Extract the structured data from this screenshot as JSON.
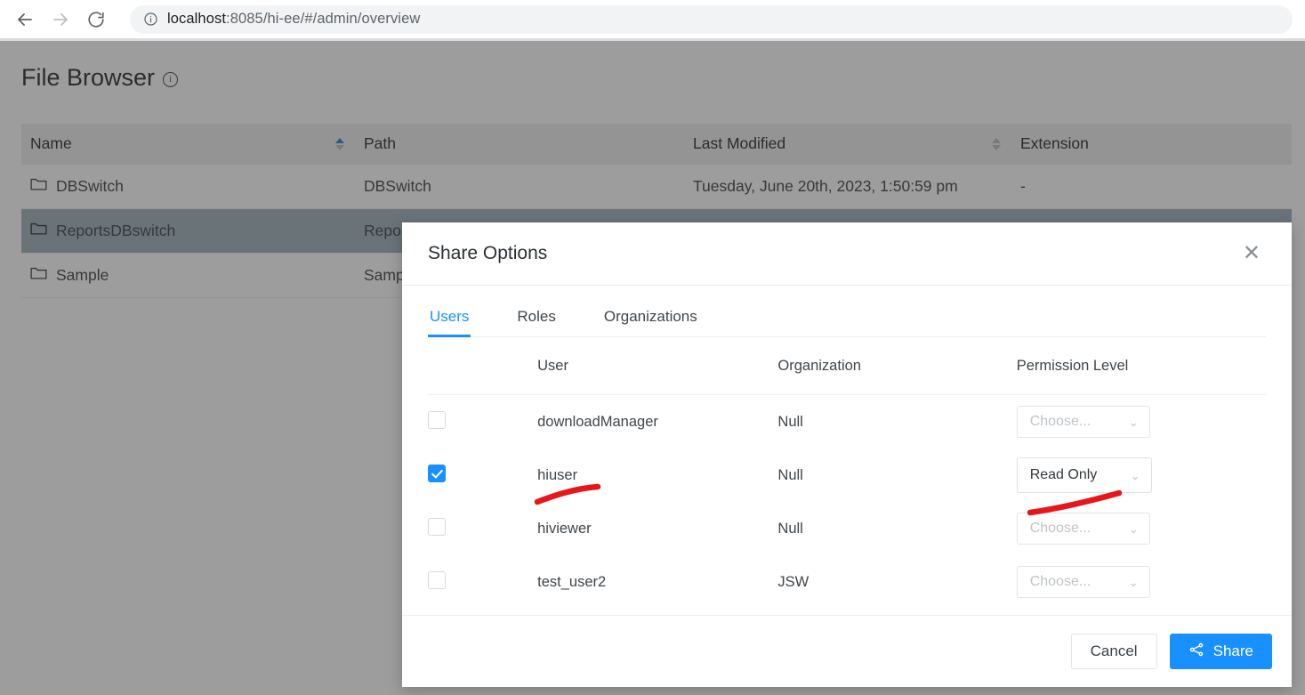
{
  "browser": {
    "back_icon": "arrow-left-icon",
    "forward_icon": "arrow-right-icon",
    "reload_icon": "reload-icon",
    "info_icon": "info-circle-icon",
    "url_host": "localhost",
    "url_rest": ":8085/hi-ee/#/admin/overview",
    "url_full": "localhost:8085/hi-ee/#/admin/overview"
  },
  "page": {
    "title": "File Browser",
    "title_info_icon": "info-circle-icon",
    "table": {
      "columns": [
        {
          "label": "Name",
          "sortable": true,
          "sort_state": "asc"
        },
        {
          "label": "Path",
          "sortable": false,
          "sort_state": "none"
        },
        {
          "label": "Last Modified",
          "sortable": true,
          "sort_state": "none"
        },
        {
          "label": "Extension",
          "sortable": false,
          "sort_state": "none"
        }
      ],
      "rows": [
        {
          "icon": "folder-icon",
          "name": "DBSwitch",
          "path": "DBSwitch",
          "last_modified": "Tuesday, June 20th, 2023, 1:50:59 pm",
          "extension": "-",
          "selected": false
        },
        {
          "icon": "folder-icon",
          "name": "ReportsDBswitch",
          "path": "ReportsDBswitch",
          "last_modified": "",
          "extension": "",
          "selected": true
        },
        {
          "icon": "folder-icon",
          "name": "Sample",
          "path": "Sample",
          "last_modified": "",
          "extension": "",
          "selected": false
        }
      ]
    }
  },
  "modal": {
    "title": "Share Options",
    "close_icon": "close-icon",
    "tabs": [
      {
        "label": "Users",
        "active": true
      },
      {
        "label": "Roles",
        "active": false
      },
      {
        "label": "Organizations",
        "active": false
      }
    ],
    "table": {
      "headers": {
        "select": "",
        "user": "User",
        "organization": "Organization",
        "permission": "Permission Level"
      },
      "rows": [
        {
          "checked": false,
          "user": "downloadManager",
          "organization": "Null",
          "permission": "Choose...",
          "permission_selected": false
        },
        {
          "checked": true,
          "user": "hiuser",
          "organization": "Null",
          "permission": "Read Only",
          "permission_selected": true
        },
        {
          "checked": false,
          "user": "hiviewer",
          "organization": "Null",
          "permission": "Choose...",
          "permission_selected": false
        },
        {
          "checked": false,
          "user": "test_user2",
          "organization": "JSW",
          "permission": "Choose...",
          "permission_selected": false
        }
      ]
    },
    "footer": {
      "cancel_label": "Cancel",
      "share_label": "Share",
      "share_icon": "share-nodes-icon"
    }
  },
  "annotations": {
    "color": "#e8161a",
    "marks": [
      {
        "name": "underline-hiuser",
        "target": "hiuser"
      },
      {
        "name": "underline-read-only",
        "target": "Read Only"
      }
    ]
  },
  "colors": {
    "accent": "#1890ff",
    "selected_row": "#9eb0b8",
    "header_bg": "#ededed",
    "backdrop": "rgba(51,51,51,0.48)",
    "annotation_red": "#e8161a"
  }
}
